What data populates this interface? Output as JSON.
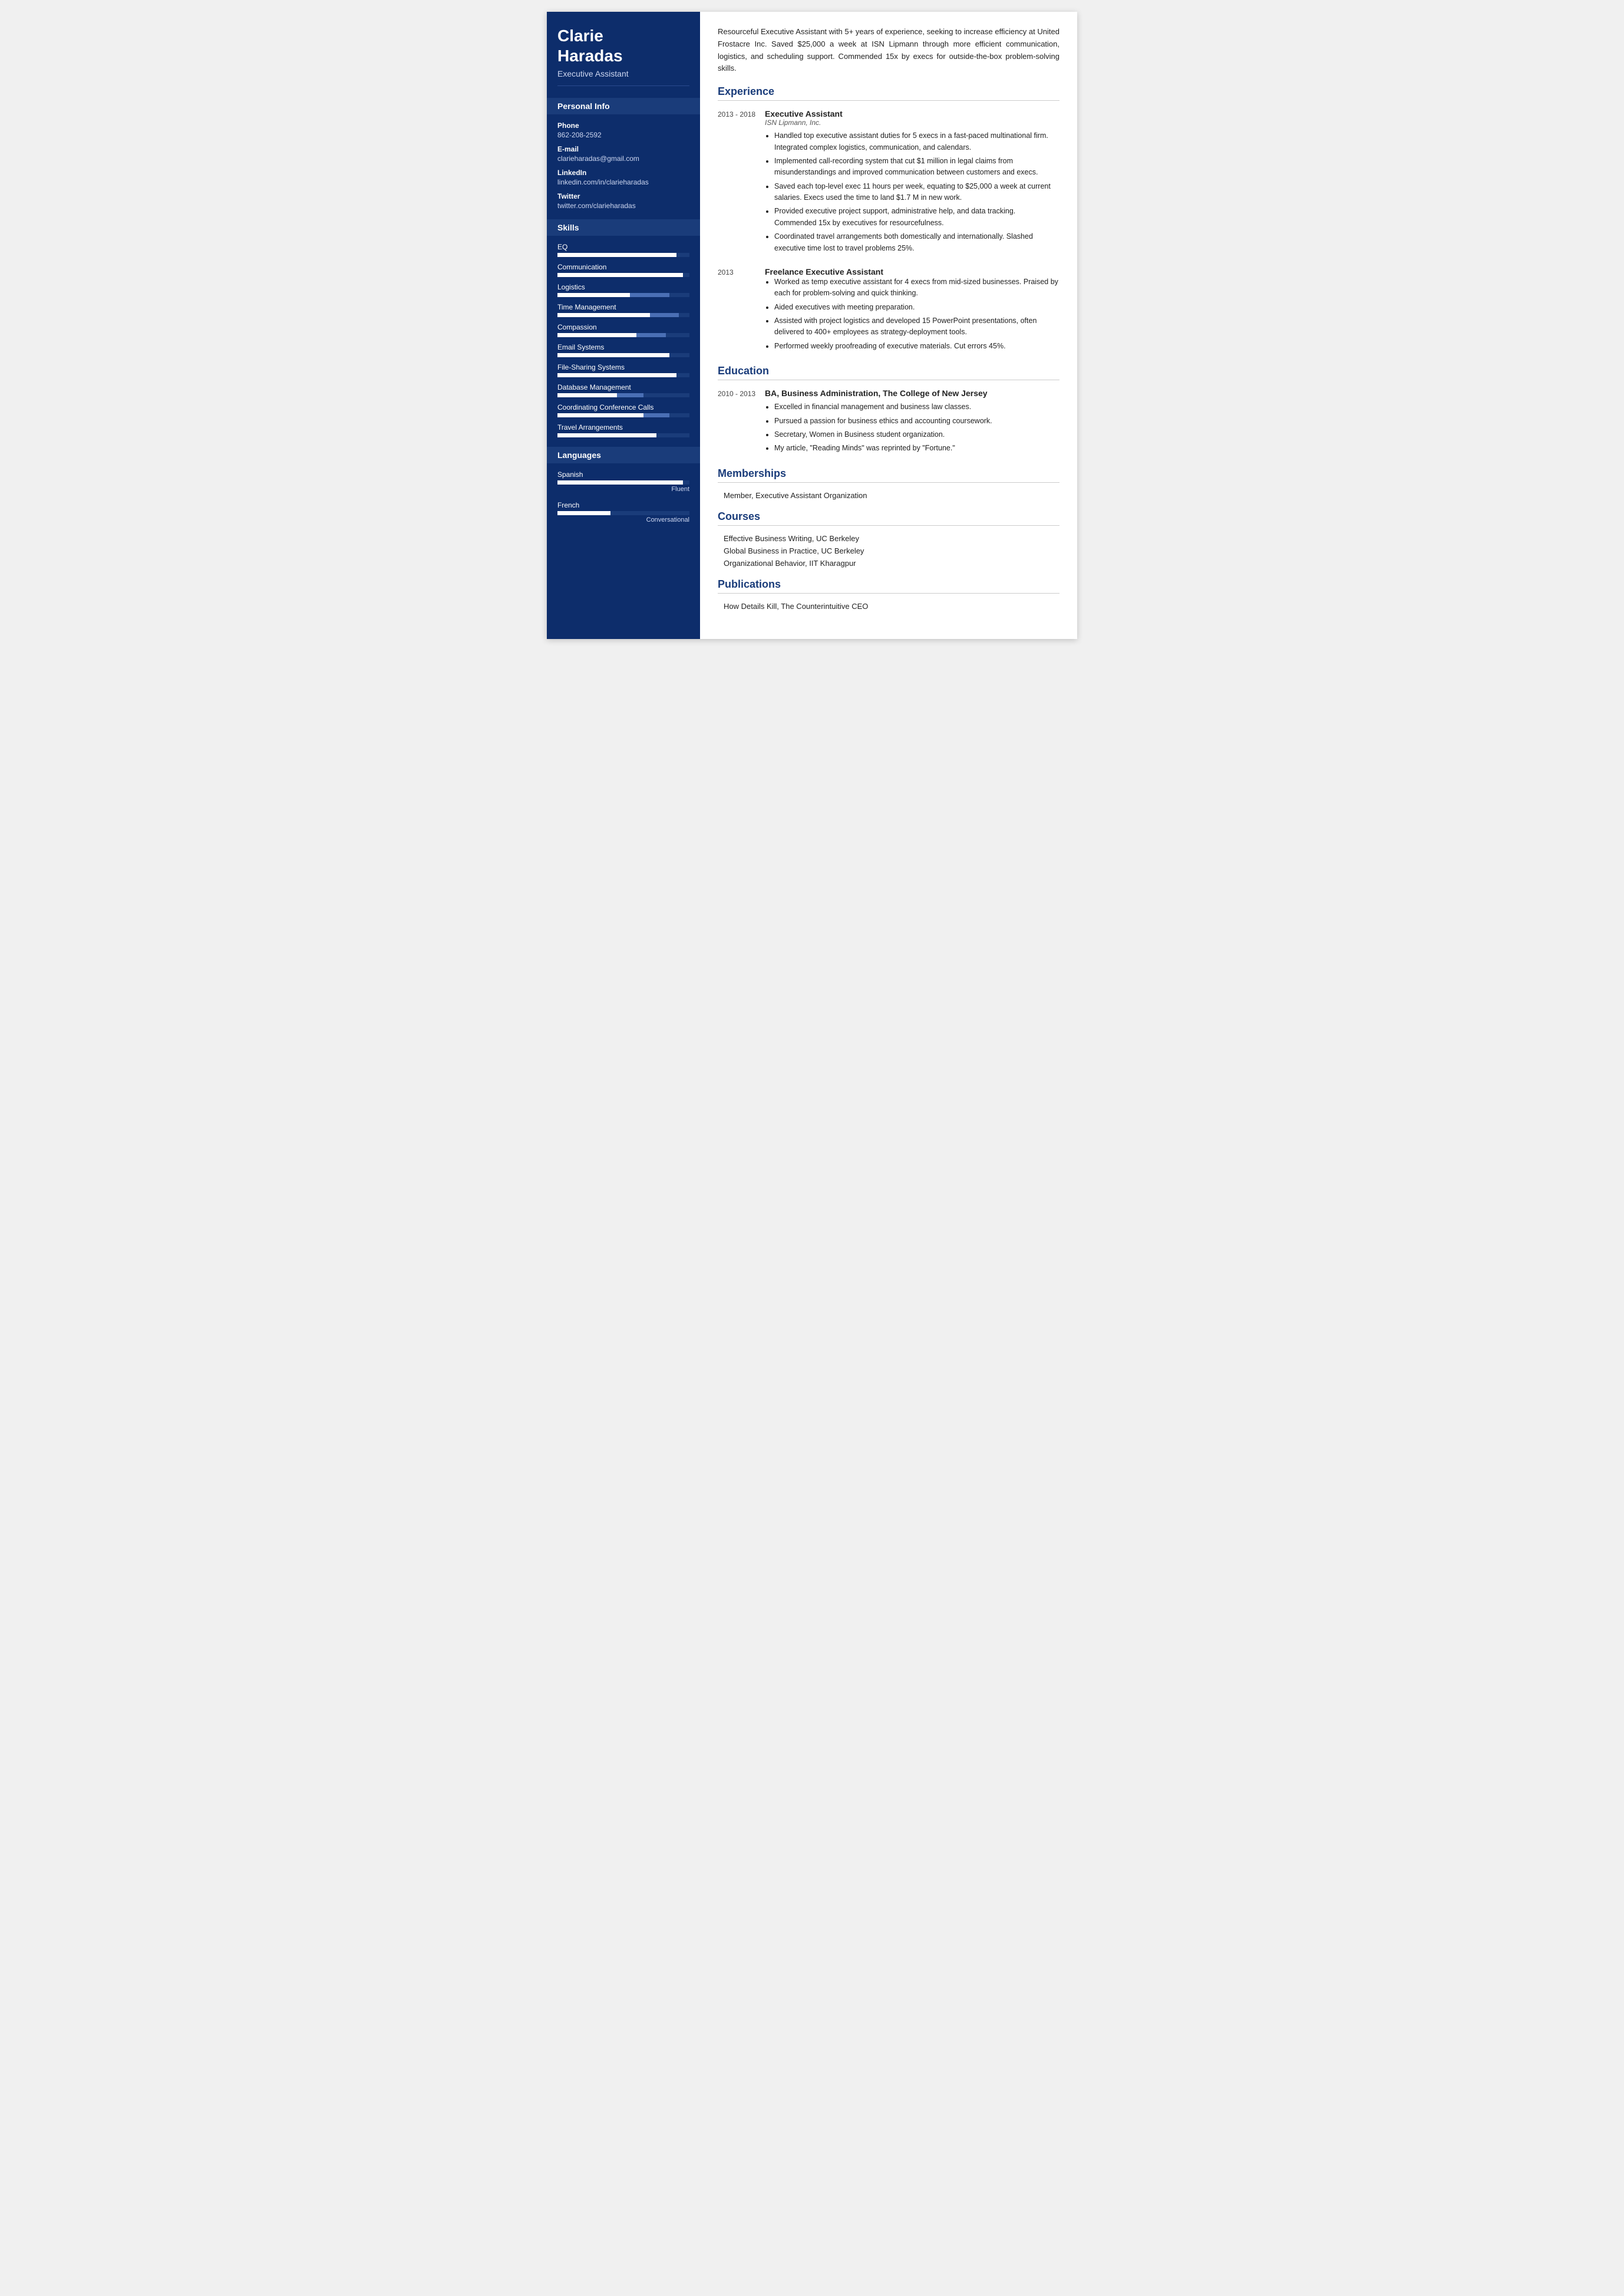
{
  "person": {
    "first_name": "Clarie",
    "last_name": "Haradas",
    "title": "Executive Assistant"
  },
  "personal_info": {
    "section_label": "Personal Info",
    "phone_label": "Phone",
    "phone": "862-208-2592",
    "email_label": "E-mail",
    "email": "clarieharadas@gmail.com",
    "linkedin_label": "LinkedIn",
    "linkedin": "linkedin.com/in/clarieharadas",
    "twitter_label": "Twitter",
    "twitter": "twitter.com/clarieharadas"
  },
  "skills": {
    "section_label": "Skills",
    "items": [
      {
        "name": "EQ",
        "fill": 90,
        "secondary_start": 0,
        "secondary_width": 0
      },
      {
        "name": "Communication",
        "fill": 95,
        "secondary_start": 0,
        "secondary_width": 0
      },
      {
        "name": "Logistics",
        "fill": 55,
        "secondary_start": 55,
        "secondary_width": 30
      },
      {
        "name": "Time Management",
        "fill": 70,
        "secondary_start": 70,
        "secondary_width": 22
      },
      {
        "name": "Compassion",
        "fill": 60,
        "secondary_start": 60,
        "secondary_width": 22
      },
      {
        "name": "Email Systems",
        "fill": 85,
        "secondary_start": 0,
        "secondary_width": 0
      },
      {
        "name": "File-Sharing Systems",
        "fill": 90,
        "secondary_start": 0,
        "secondary_width": 0
      },
      {
        "name": "Database Management",
        "fill": 45,
        "secondary_start": 45,
        "secondary_width": 20
      },
      {
        "name": "Coordinating Conference Calls",
        "fill": 65,
        "secondary_start": 65,
        "secondary_width": 20
      },
      {
        "name": "Travel Arrangements",
        "fill": 75,
        "secondary_start": 0,
        "secondary_width": 0
      }
    ]
  },
  "languages": {
    "section_label": "Languages",
    "items": [
      {
        "name": "Spanish",
        "fill": 95,
        "level": "Fluent"
      },
      {
        "name": "French",
        "fill": 40,
        "level": "Conversational"
      }
    ]
  },
  "summary": "Resourceful Executive Assistant with 5+ years of experience, seeking to increase efficiency at United Frostacre Inc. Saved $25,000 a week at ISN Lipmann through more efficient communication, logistics, and scheduling support. Commended 15x by execs for outside-the-box problem-solving skills.",
  "experience": {
    "section_label": "Experience",
    "items": [
      {
        "date": "2013 - 2018",
        "title": "Executive Assistant",
        "company": "ISN Lipmann, Inc.",
        "bullets": [
          "Handled top executive assistant duties for 5 execs in a fast-paced multinational firm. Integrated complex logistics, communication, and calendars.",
          "Implemented call-recording system that cut $1 million in legal claims from misunderstandings and improved communication between customers and execs.",
          "Saved each top-level exec 11 hours per week, equating to $25,000 a week at current salaries. Execs used the time to land $1.7 M in new work.",
          "Provided executive project support, administrative help, and data tracking. Commended 15x by executives for resourcefulness.",
          "Coordinated travel arrangements both domestically and internationally. Slashed executive time lost to travel problems 25%."
        ]
      },
      {
        "date": "2013",
        "title": "Freelance Executive Assistant",
        "company": "",
        "bullets": [
          "Worked as temp executive assistant for 4 execs from mid-sized businesses. Praised by each for problem-solving and quick thinking.",
          "Aided executives with meeting preparation.",
          "Assisted with project logistics and developed 15 PowerPoint presentations, often delivered to 400+ employees as strategy-deployment tools.",
          "Performed weekly proofreading of executive materials. Cut errors 45%."
        ]
      }
    ]
  },
  "education": {
    "section_label": "Education",
    "items": [
      {
        "date": "2010 - 2013",
        "degree": "BA, Business Administration, The College of New Jersey",
        "bullets": [
          "Excelled in financial management and business law classes.",
          "Pursued a passion for business ethics and accounting coursework.",
          "Secretary, Women in Business student organization.",
          "My article, \"Reading Minds\" was reprinted by \"Fortune.\""
        ]
      }
    ]
  },
  "memberships": {
    "section_label": "Memberships",
    "items": [
      "Member, Executive Assistant Organization"
    ]
  },
  "courses": {
    "section_label": "Courses",
    "items": [
      "Effective Business Writing, UC Berkeley",
      "Global Business in Practice, UC Berkeley",
      "Organizational Behavior, IIT Kharagpur"
    ]
  },
  "publications": {
    "section_label": "Publications",
    "items": [
      "How Details Kill, The Counterintuitive CEO"
    ]
  }
}
